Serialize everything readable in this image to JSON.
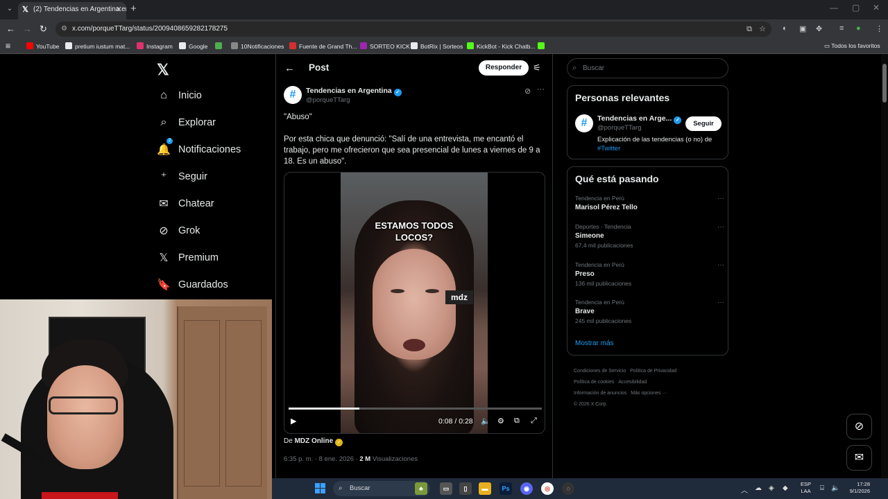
{
  "browser": {
    "tab_title": "(2) Tendencias en Argentina en X",
    "url": "x.com/porqueTTarg/status/2009408659282178275",
    "bookmarks": [
      {
        "label": "YouTube",
        "color": "#ff0000"
      },
      {
        "label": "pretium iustum mat...",
        "color": "#e8eaed"
      },
      {
        "label": "Instagram",
        "color": "#e1306c"
      },
      {
        "label": "Google",
        "color": "#e8eaed"
      },
      {
        "label": "",
        "color": "#4caf50"
      },
      {
        "label": "10Notificaciones",
        "color": "#888888"
      },
      {
        "label": "Fuente de Grand Th...",
        "color": "#d32f2f"
      },
      {
        "label": "SORTEO KICK",
        "color": "#9c27b0"
      },
      {
        "label": "BotRix | Sorteos",
        "color": "#e8eaed"
      },
      {
        "label": "KickBot - Kick Chatb...",
        "color": "#53fc18"
      },
      {
        "label": "",
        "color": "#53fc18"
      }
    ],
    "all_bookmarks": "Todos los favoritos"
  },
  "nav": {
    "items": [
      {
        "label": "Inicio",
        "icon": "⌂"
      },
      {
        "label": "Explorar",
        "icon": "⌕"
      },
      {
        "label": "Notificaciones",
        "icon": "🔔"
      },
      {
        "label": "Seguir",
        "icon": "⁺"
      },
      {
        "label": "Chatear",
        "icon": "✉"
      },
      {
        "label": "Grok",
        "icon": "⊘"
      },
      {
        "label": "Premium",
        "icon": "𝕏"
      },
      {
        "label": "Guardados",
        "icon": "🔖"
      }
    ],
    "notif_count": "2"
  },
  "post": {
    "header_title": "Post",
    "reply_label": "Responder",
    "author_name": "Tendencias en Argentina",
    "author_handle": "@porqueTTarg",
    "text_1": "\"Abuso\"",
    "text_2": "Por esta chica que denunció: \"Salí de una entrevista, me encantó el trabajo, pero me ofrecieron que sea presencial de lunes a viernes de 9 a 18. Es un abuso\".",
    "video_overlay_1": "ESTAMOS TODOS",
    "video_overlay_2": "LOCOS?",
    "video_watermark": "mdz",
    "video_time": "0:08 / 0:28",
    "video_progress": 0.28,
    "from_prefix": "De",
    "from_source": "MDZ Online",
    "timestamp": "6:35 p. m. · 8 ene. 2026 ·",
    "views_count": "2 M",
    "views_label": "Visualizaciones"
  },
  "sidebar": {
    "search_placeholder": "Buscar",
    "relevant_title": "Personas relevantes",
    "relevant_name": "Tendencias en Arge...",
    "relevant_handle": "@porqueTTarg",
    "follow_label": "Seguir",
    "relevant_bio": "Explicación de las tendencias (o no) de",
    "relevant_bio_link": "#Twitter",
    "trends_title": "Qué está pasando",
    "trends": [
      {
        "category": "Tendencia en Perú",
        "name": "Marisol Pérez Tello",
        "count": ""
      },
      {
        "category": "Deportes · Tendencia",
        "name": "Simeone",
        "count": "67,4 mil publicaciones"
      },
      {
        "category": "Tendencia en Perú",
        "name": "Preso",
        "count": "136 mil publicaciones"
      },
      {
        "category": "Tendencia en Perú",
        "name": "Brave",
        "count": "245 mil publicaciones"
      }
    ],
    "show_more": "Mostrar más",
    "footer": [
      "Condiciones de Servicio",
      "Política de Privacidad",
      "Política de cookies",
      "Accesibilidad",
      "Información de anuncios",
      "Más opciones ···",
      "© 2026 X Corp."
    ]
  },
  "taskbar": {
    "search_label": "Buscar",
    "lang_1": "ESP",
    "lang_2": "LAA",
    "time": "17:28",
    "date": "9/1/2026"
  }
}
